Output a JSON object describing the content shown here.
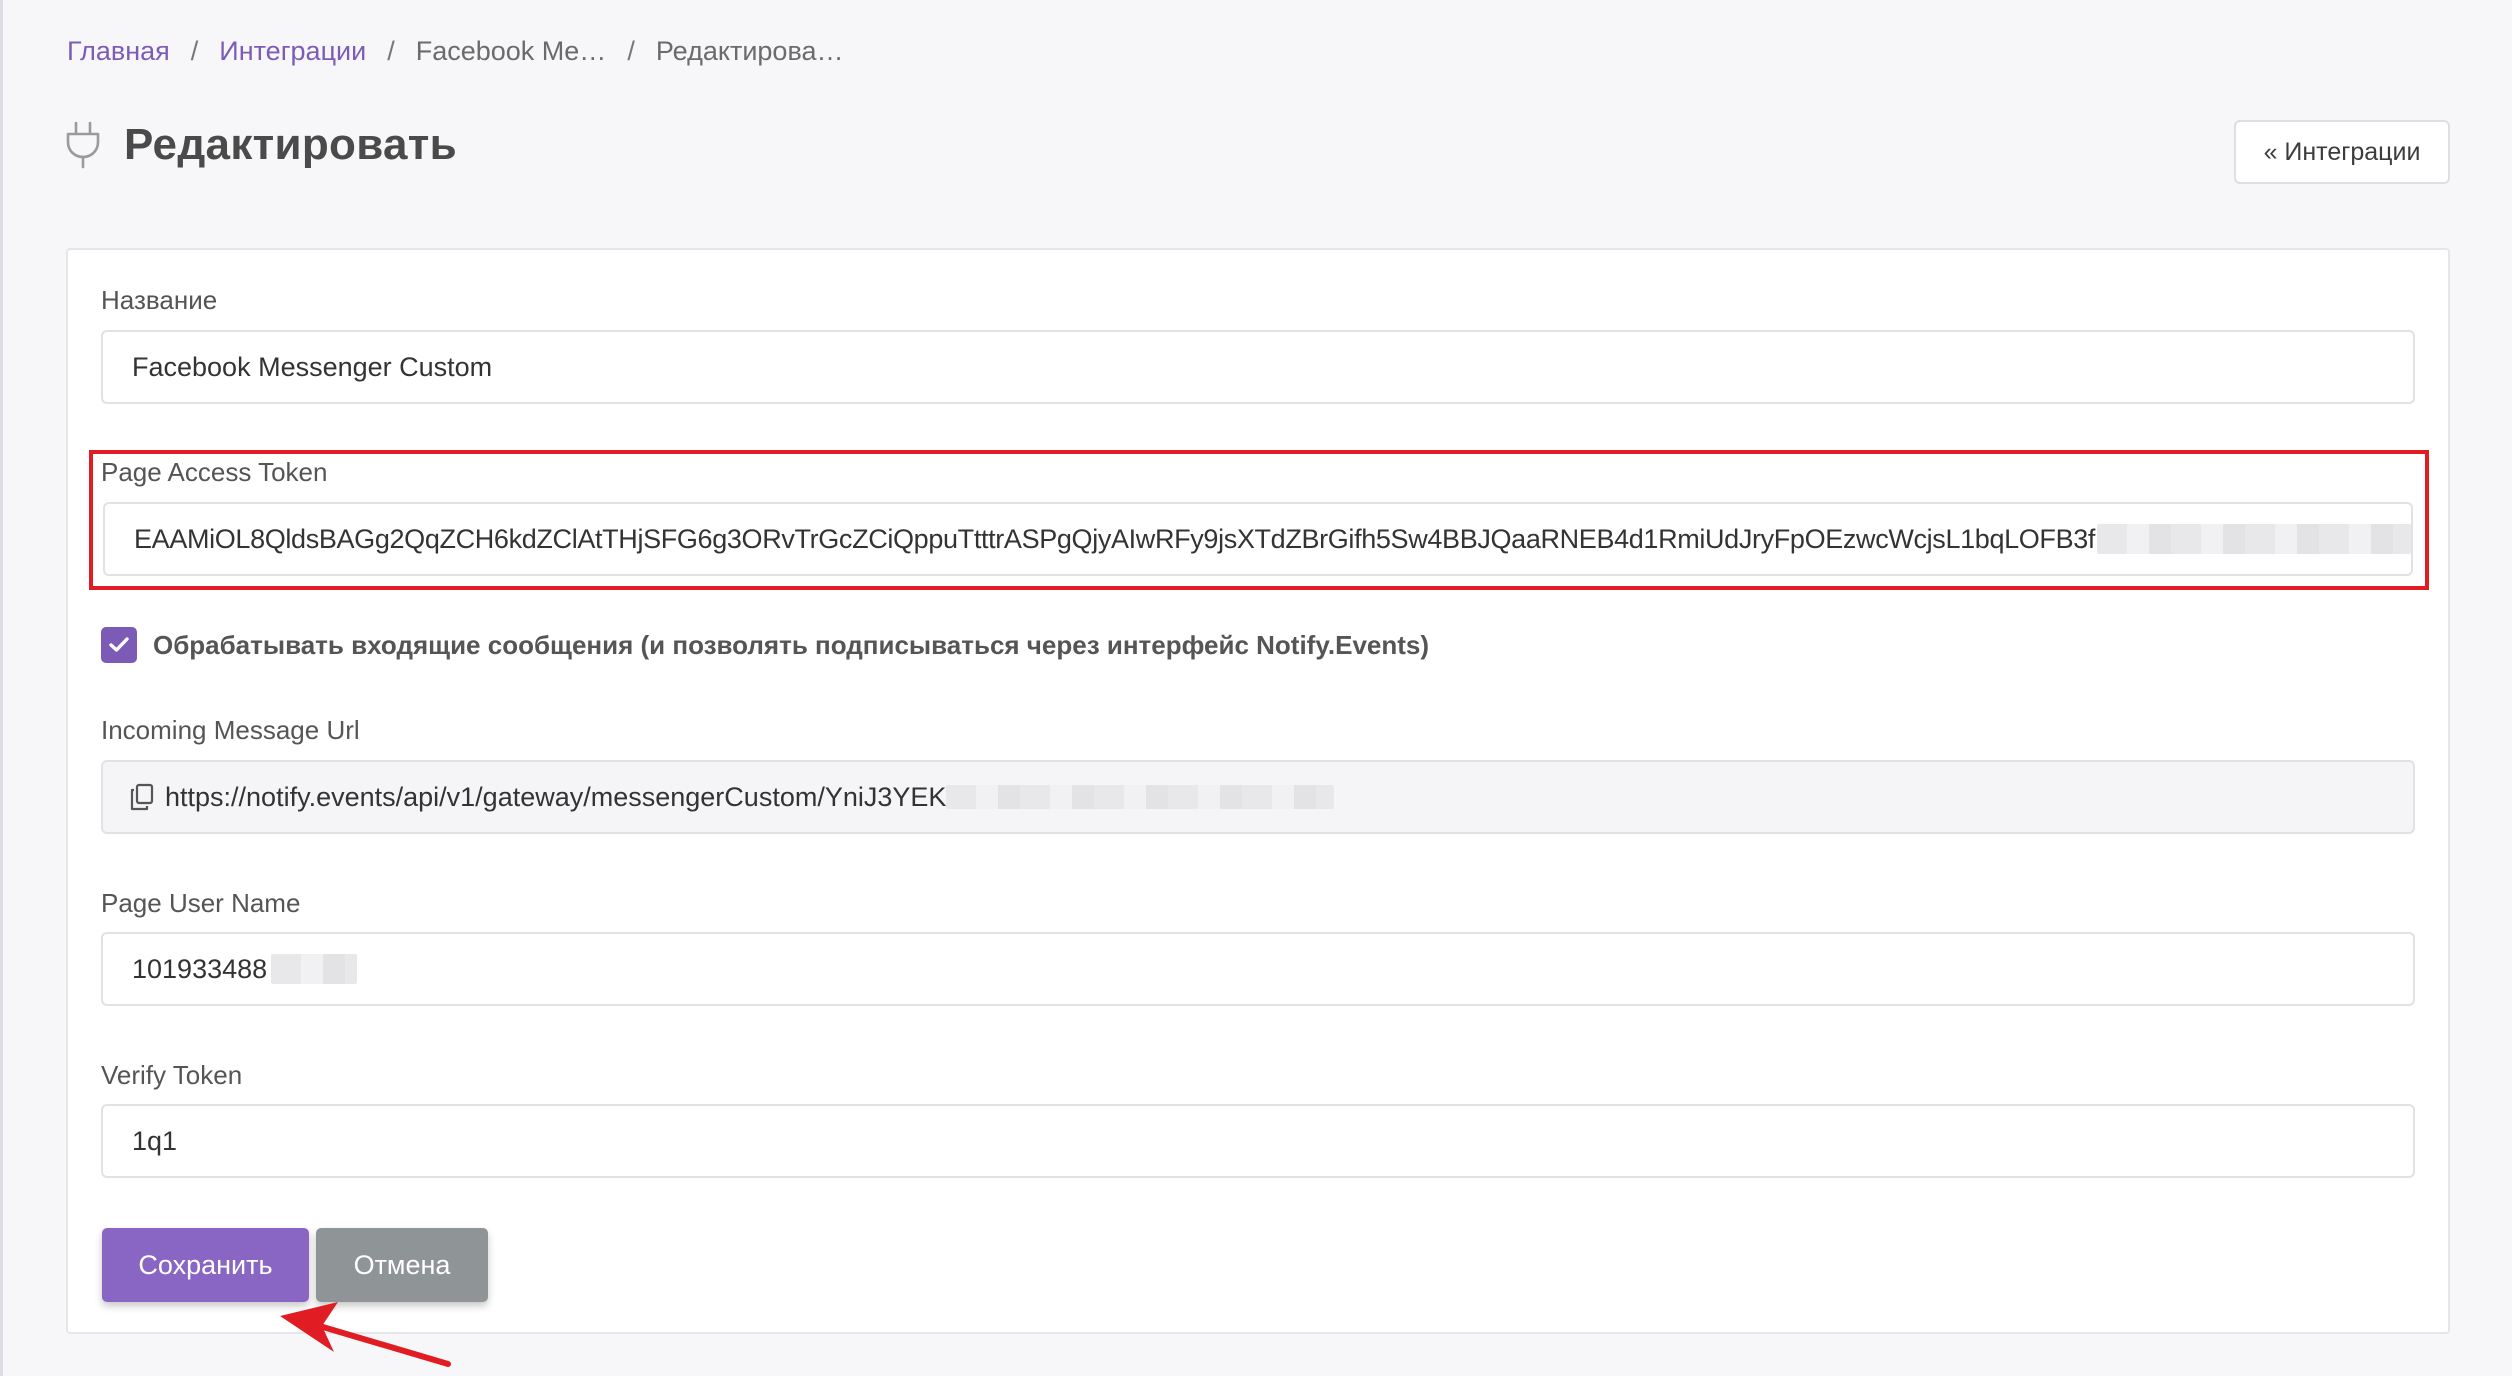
{
  "breadcrumb": {
    "items": [
      "Главная",
      "Интеграции",
      "Facebook Me…",
      "Редактирова…"
    ],
    "separator": "/"
  },
  "header": {
    "title": "Редактировать",
    "title_icon": "plug-icon",
    "back_button_label": "« Интеграции"
  },
  "form": {
    "name": {
      "label": "Название",
      "value": "Facebook Messenger Custom"
    },
    "page_access_token": {
      "label": "Page Access Token",
      "value_visible": "EAAMiOL8QldsBAGg2QqZCH6kdZClAtTHjSFG6g3ORvTrGcZCiQppuTtttrASPgQjyAIwRFy9jsXTdZBrGifh5Sw4BBJQaaRNEB4d1RmiUdJryFpOEzwcWcjsL1bqLOFB3f",
      "highlighted": true,
      "highlight_color": "#e11d24"
    },
    "process_incoming": {
      "checked": true,
      "label": "Обрабатывать входящие сообщения (и позволять подписываться через интерфейс Notify.Events)"
    },
    "incoming_message_url": {
      "label": "Incoming Message Url",
      "value_visible": "https://notify.events/api/v1/gateway/messengerCustom/YniJ3YEK",
      "icon": "copy-icon",
      "readonly": true
    },
    "page_user_name": {
      "label": "Page User Name",
      "value_visible": "101933488"
    },
    "verify_token": {
      "label": "Verify Token",
      "value": "1q1"
    }
  },
  "buttons": {
    "save_label": "Сохранить",
    "cancel_label": "Отмена"
  },
  "colors": {
    "accent": "#7b5bb5",
    "save_button": "#8a66c4",
    "cancel_button": "#8f9497",
    "annotation_arrow": "#e11d24"
  }
}
